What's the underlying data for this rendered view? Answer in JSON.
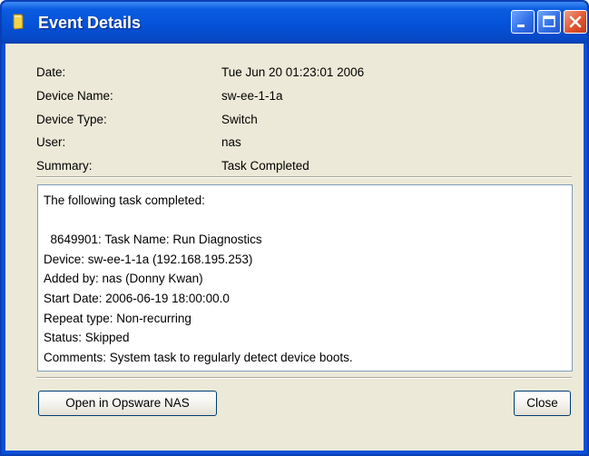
{
  "window": {
    "title": "Event Details",
    "icon": "document-icon"
  },
  "fields": [
    {
      "label": "Date:",
      "value": "Tue Jun 20 01:23:01 2006"
    },
    {
      "label": "Device Name:",
      "value": "sw-ee-1-1a"
    },
    {
      "label": "Device Type:",
      "value": "Switch"
    },
    {
      "label": "User:",
      "value": "nas"
    },
    {
      "label": "Summary:",
      "value": "Task Completed"
    }
  ],
  "details": {
    "lines": [
      "The following task completed:",
      "",
      "  8649901: Task Name: Run Diagnostics",
      "Device: sw-ee-1-1a (192.168.195.253)",
      "Added by: nas (Donny Kwan)",
      "Start Date: 2006-06-19 18:00:00.0",
      "Repeat type: Non-recurring",
      "Status: Skipped",
      "Comments: System task to regularly detect device boots."
    ]
  },
  "buttons": {
    "open_label": "Open in Opsware NAS",
    "close_label": "Close"
  },
  "colors": {
    "titlebar": "#0552d8",
    "client_bg": "#ece9d8",
    "close_button": "#e0542f"
  }
}
